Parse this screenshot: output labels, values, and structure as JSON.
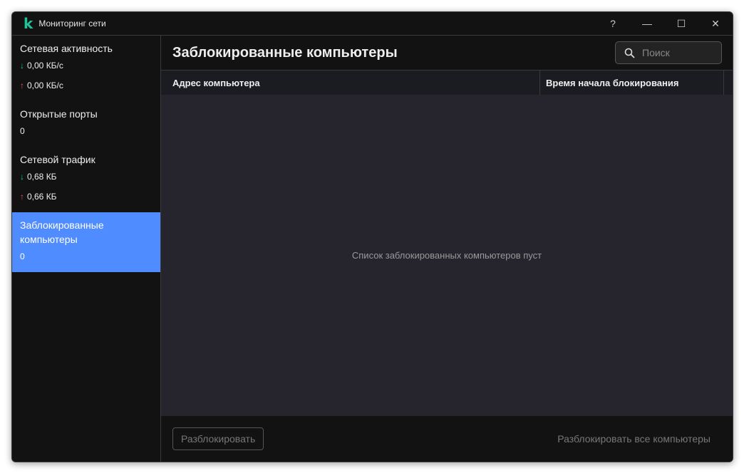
{
  "window": {
    "title": "Мониторинг сети",
    "help": "?"
  },
  "sidebar": {
    "items": [
      {
        "label": "Сетевая активность",
        "down": "0,00 КБ/с",
        "up": "0,00 КБ/с"
      },
      {
        "label": "Открытые порты",
        "value": "0"
      },
      {
        "label": "Сетевой трафик",
        "down": "0,68 КБ",
        "up": "0,66 КБ"
      },
      {
        "label": "Заблокированные компьютеры",
        "value": "0"
      }
    ]
  },
  "main": {
    "title": "Заблокированные компьютеры",
    "search_placeholder": "Поиск",
    "columns": [
      "Адрес компьютера",
      "Время начала блокирования"
    ],
    "empty": "Список заблокированных компьютеров пуст",
    "unblock": "Разблокировать",
    "unblock_all": "Разблокировать все компьютеры"
  }
}
